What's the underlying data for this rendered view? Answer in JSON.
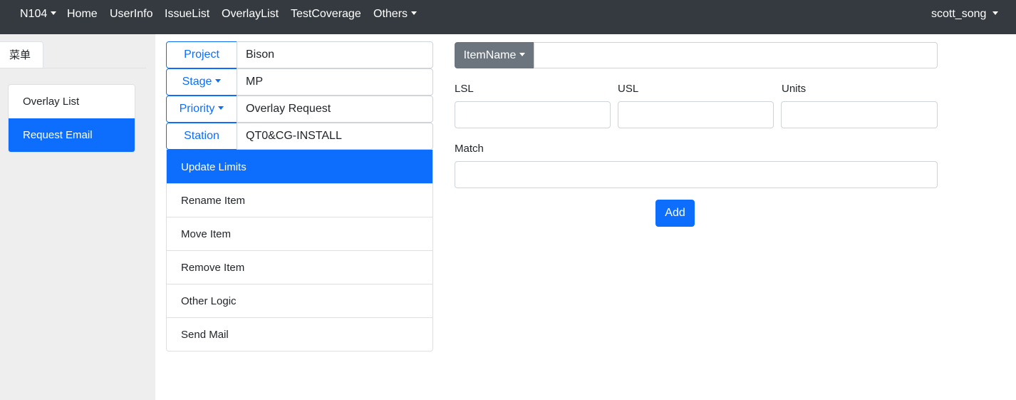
{
  "navbar": {
    "brand": "N104",
    "items": [
      "Home",
      "UserInfo",
      "IssueList",
      "OverlayList",
      "TestCoverage"
    ],
    "others": "Others",
    "user": "scott_song"
  },
  "sidebar": {
    "menu_tab": "菜单",
    "items": [
      "Overlay List",
      "Request Email"
    ],
    "active": "Request Email"
  },
  "fields": {
    "project": {
      "label": "Project",
      "value": "Bison"
    },
    "stage": {
      "label": "Stage",
      "value": "MP"
    },
    "priority": {
      "label": "Priority",
      "value": "Overlay Request"
    },
    "station": {
      "label": "Station",
      "value": "QT0&CG-INSTALL"
    }
  },
  "actions": {
    "items": [
      "Update Limits",
      "Rename Item",
      "Move Item",
      "Remove Item",
      "Other Logic",
      "Send Mail"
    ],
    "active": "Update Limits"
  },
  "form": {
    "itemname_label": "ItemName",
    "itemname_value": "",
    "lsl_label": "LSL",
    "lsl_value": "",
    "usl_label": "USL",
    "usl_value": "",
    "units_label": "Units",
    "units_value": "",
    "match_label": "Match",
    "match_value": "",
    "add_label": "Add"
  },
  "colors": {
    "navbar": "#343a40",
    "primary": "#0d6efd",
    "secondary": "#6c757d",
    "sidebar_bg": "#eeeeee"
  }
}
